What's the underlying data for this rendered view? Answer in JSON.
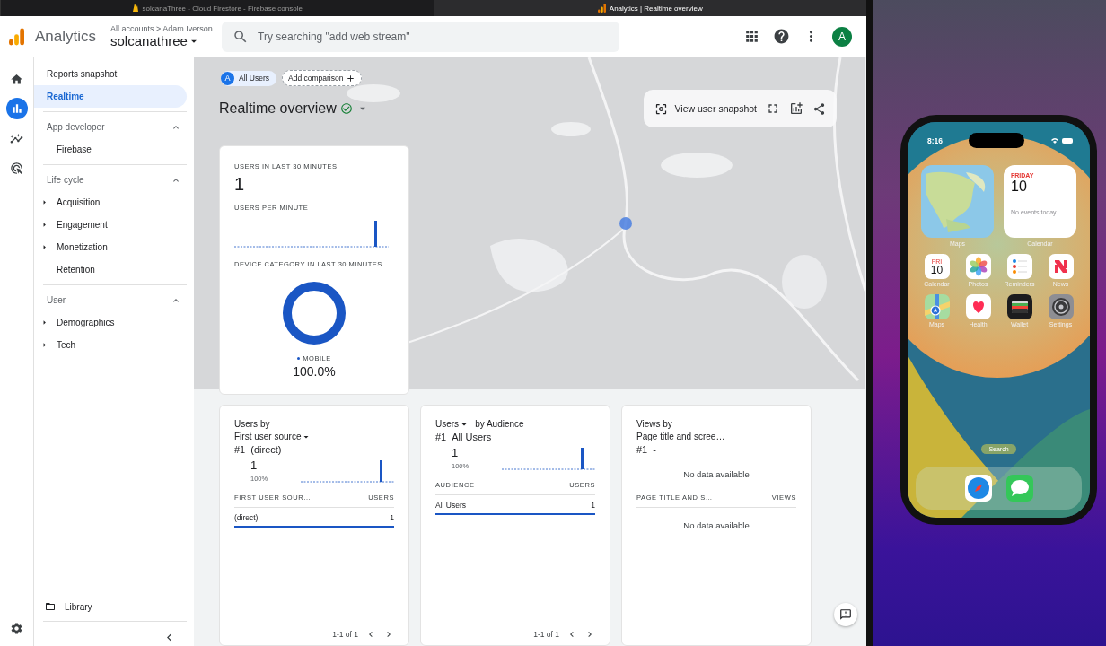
{
  "browser_tabs": [
    {
      "title": "solcanaThree - Cloud Firestore - Firebase console",
      "selected": false
    },
    {
      "title": "Analytics | Realtime overview",
      "selected": true
    }
  ],
  "header": {
    "product": "Analytics",
    "breadcrumb": "All accounts > Adam Iverson",
    "property": "solcanathree",
    "search_placeholder": "Try searching \"add web stream\"",
    "avatar": "A"
  },
  "rail": [
    {
      "kind": "home",
      "selected": false
    },
    {
      "kind": "reports",
      "selected": true
    },
    {
      "kind": "explore",
      "selected": false
    },
    {
      "kind": "advertising",
      "selected": false
    }
  ],
  "nav": [
    {
      "kind": "link",
      "label": "Reports snapshot",
      "selected": false
    },
    {
      "kind": "link",
      "label": "Realtime",
      "selected": true
    },
    {
      "kind": "section",
      "label": "App developer",
      "expanded": true,
      "children": [
        {
          "label": "Firebase",
          "expandable": false
        }
      ]
    },
    {
      "kind": "section",
      "label": "Life cycle",
      "expanded": true,
      "children": [
        {
          "label": "Acquisition",
          "expandable": true
        },
        {
          "label": "Engagement",
          "expandable": true
        },
        {
          "label": "Monetization",
          "expandable": true
        },
        {
          "label": "Retention",
          "expandable": false
        }
      ]
    },
    {
      "kind": "section",
      "label": "User",
      "expanded": true,
      "children": [
        {
          "label": "Demographics",
          "expandable": true
        },
        {
          "label": "Tech",
          "expandable": true
        }
      ]
    }
  ],
  "library": "Library",
  "comparison": {
    "badge": "A",
    "segment": "All Users",
    "add": "Add comparison"
  },
  "title": "Realtime overview",
  "snapshot_button": "View user snapshot",
  "summary": {
    "users_label": "USERS IN LAST 30 MINUTES",
    "users": "1",
    "per_minute_label": "USERS PER MINUTE",
    "device_label": "DEVICE CATEGORY IN LAST 30 MINUTES",
    "legend": "MOBILE",
    "share": "100.0%"
  },
  "cards": [
    {
      "kind": "data",
      "heading": [
        [
          {
            "text": "Users by",
            "dropdown": false
          }
        ],
        [
          {
            "text": "First user source",
            "dropdown": true
          }
        ]
      ],
      "rank": "#1",
      "top": "(direct)",
      "value": "1",
      "share": "100%",
      "columns": [
        "FIRST USER SOUR…",
        "USERS"
      ],
      "rows": [
        {
          "cells": [
            "(direct)",
            "1"
          ],
          "level": 1
        }
      ],
      "pagination": "1-1 of 1"
    },
    {
      "kind": "data",
      "heading": [
        [
          {
            "text": "Users",
            "dropdown": true
          },
          {
            "text": "by Audience",
            "dropdown": false
          }
        ]
      ],
      "rank": "#1",
      "top": "All Users",
      "value": "1",
      "share": "100%",
      "columns": [
        "AUDIENCE",
        "USERS"
      ],
      "rows": [
        {
          "cells": [
            "All Users",
            "1"
          ],
          "level": 1
        }
      ],
      "pagination": "1-1 of 1"
    },
    {
      "kind": "empty",
      "heading": [
        [
          {
            "text": "Views by",
            "dropdown": false
          }
        ],
        [
          {
            "text": "Page title and scree…",
            "dropdown": false
          }
        ]
      ],
      "rank": "#1",
      "top": "-",
      "empty": "No data available",
      "columns": [
        "PAGE TITLE AND S…",
        "VIEWS"
      ],
      "empty_table": "No data available"
    }
  ],
  "phone": {
    "time": "8:16",
    "map_widget": {
      "label": "Maps"
    },
    "calendar_widget": {
      "day": "FRIDAY",
      "date": "10",
      "note": "No events today",
      "label": "Calendar"
    },
    "apps": [
      {
        "kind": "calendar",
        "label": "Calendar",
        "day": "FRI",
        "date": "10"
      },
      {
        "kind": "photos",
        "label": "Photos"
      },
      {
        "kind": "reminders",
        "label": "Reminders"
      },
      {
        "kind": "news",
        "label": "News"
      },
      {
        "kind": "maps",
        "label": "Maps"
      },
      {
        "kind": "health",
        "label": "Health"
      },
      {
        "kind": "wallet",
        "label": "Wallet"
      },
      {
        "kind": "settings",
        "label": "Settings"
      }
    ],
    "search": "Search",
    "dock": [
      {
        "kind": "safari"
      },
      {
        "kind": "messages"
      }
    ]
  }
}
